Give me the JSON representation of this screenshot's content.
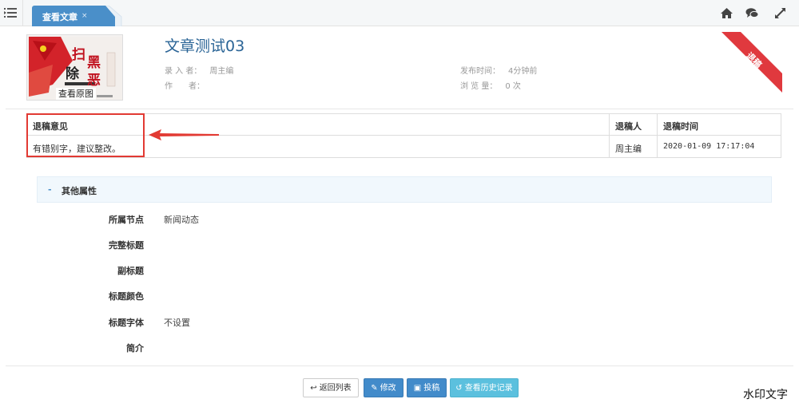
{
  "tabs": [
    {
      "label": "查看文章",
      "close": "×"
    }
  ],
  "toolbar": {
    "icons": [
      "menu-toggle-icon",
      "home-icon",
      "comments-icon",
      "fullscreen-icon"
    ]
  },
  "article": {
    "title": "文章测试03",
    "cover_button": "查看原图",
    "cover_art_text": [
      "扫",
      "黑",
      "除",
      "恶"
    ],
    "meta": {
      "entry_label": "录 入 者：",
      "entry_value": "周主编",
      "author_label": "作　　者：",
      "author_value": "",
      "publish_label": "发布时间：",
      "publish_value": "4分钟前",
      "views_label": "浏 览 量：",
      "views_value": "0 次"
    },
    "status_ribbon": "退稿"
  },
  "reject_table": {
    "headers": [
      "退稿意见",
      "退稿人",
      "退稿时间"
    ],
    "rows": [
      {
        "opinion": "有错别字，建议整改。",
        "user": "周主编",
        "time": "2020-01-09 17:17:04"
      }
    ]
  },
  "other_props": {
    "toggle": "-",
    "title": "其他属性",
    "items": [
      {
        "label": "所属节点",
        "value": "新闻动态"
      },
      {
        "label": "完整标题",
        "value": ""
      },
      {
        "label": "副标题",
        "value": ""
      },
      {
        "label": "标题颜色",
        "value": ""
      },
      {
        "label": "标题字体",
        "value": "不设置"
      },
      {
        "label": "简介",
        "value": ""
      }
    ]
  },
  "buttons": {
    "back": "返回列表",
    "edit": "修改",
    "submit": "投稿",
    "history": "查看历史记录"
  },
  "watermark": "水印文字",
  "colors": {
    "accent": "#4a8fc9",
    "ribbon": "#e0393e",
    "highlight": "#e23a33"
  }
}
